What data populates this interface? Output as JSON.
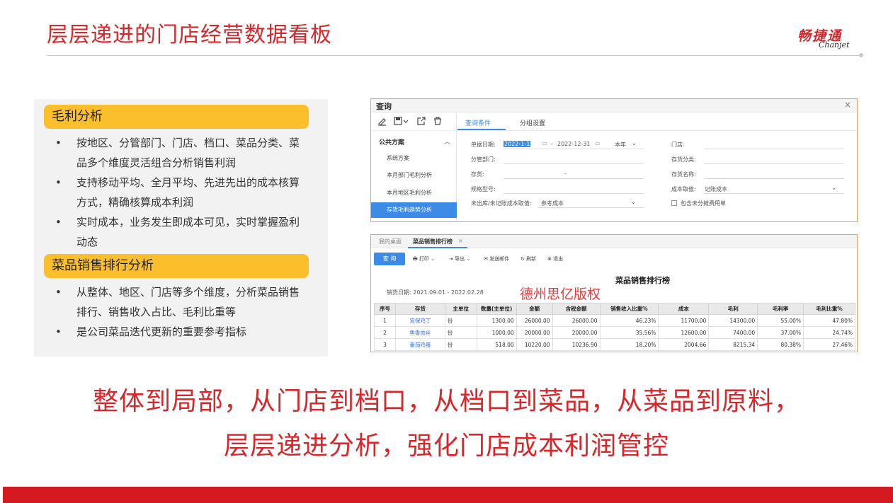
{
  "page": {
    "title": "层层递进的门店经营数据看板",
    "logo_cn": "畅捷通",
    "logo_en": "Chanjet"
  },
  "left_panel": {
    "sections": [
      {
        "heading": "毛利分析",
        "bullets": [
          [
            "按地区、分管部门、门店、档口、菜品分类、菜",
            "品多个维度灵活组合分析销售利润"
          ],
          [
            "支持移动平均、全月平均、先进先出的成本核算",
            "方式，精确核算成本利润"
          ],
          [
            "实时成本，业务发生即成本可见，实时掌握盈利",
            "动态"
          ]
        ]
      },
      {
        "heading": "菜品销售排行分析",
        "bullets": [
          [
            "从整体、地区、门店等多个维度，分析菜品销售",
            "排行、销售收入占比、毛利比重等"
          ],
          [
            "是公司菜品迭代更新的重要参考指标"
          ]
        ]
      }
    ]
  },
  "query_window": {
    "title": "查询",
    "close": "×",
    "sidebar": {
      "heading": "公共方案",
      "items": [
        "系统方案",
        "本月部门毛利分析",
        "本月地区毛利分析",
        "存货毛利趋势分析"
      ],
      "active_index": 3
    },
    "tabs": [
      "查询条件",
      "分组设置"
    ],
    "active_tab": 0,
    "fields": {
      "date_label": "单据日期:",
      "date_from": "2022-1-1",
      "date_sep": "-",
      "date_to": "2022-12-31",
      "period": "本年",
      "store_label": "门店:",
      "dept_label": "分管部门:",
      "inv_class_label": "存货分类:",
      "inventory_label": "存货:",
      "inventory_sep": "-",
      "inv_name_label": "存货名称:",
      "spec_label": "规格型号:",
      "cost_label": "成本取值:",
      "cost_value": "记账成本",
      "unposted_label": "未出库/未记账成本取值:",
      "unposted_value": "参考成本",
      "include_label": "包含未分摊费用单"
    }
  },
  "rank_window": {
    "tabs": [
      "我的桌面",
      "菜品销售排行榜"
    ],
    "active_tab": 1,
    "tab_close": "×",
    "query_button": "查 询",
    "tools": [
      "打印",
      "导出",
      "发送邮件",
      "刷新",
      "退出"
    ],
    "report_title": "菜品销售排行榜",
    "date_text": "销货日期:  2021.09.01 - 2022.02.28",
    "watermark": "德州思亿版权",
    "columns": [
      "序号",
      "存货",
      "主单位",
      "数量(主单位)",
      "金额",
      "含税金额",
      "销售收入比重%",
      "成本",
      "毛利",
      "毛利率",
      "毛利比重%"
    ],
    "rows": [
      [
        "1",
        "宫保鸡丁",
        "份",
        "1300.00",
        "26000.00",
        "26000.00",
        "46.23%",
        "11700.00",
        "14300.00",
        "55.00%",
        "47.80%"
      ],
      [
        "2",
        "鱼香肉丝",
        "份",
        "1000.00",
        "20000.00",
        "20000.00",
        "35.56%",
        "12600.00",
        "7400.00",
        "37.00%",
        "24.74%"
      ],
      [
        "3",
        "番茄鸡蛋",
        "份",
        "518.00",
        "10220.00",
        "10236.90",
        "18.20%",
        "2004.66",
        "8215.34",
        "80.38%",
        "27.46%"
      ]
    ]
  },
  "slogan": {
    "line1": "整体到局部，从门店到档口，从档口到菜品，从菜品到原料，",
    "line2": "层层递进分析，强化门店成本利润管控"
  },
  "colors": {
    "brand_red": "#d9262b",
    "section_yellow": "#fbbf2c",
    "accent_blue": "#3c8ce7",
    "window_border": "#f0a060"
  }
}
